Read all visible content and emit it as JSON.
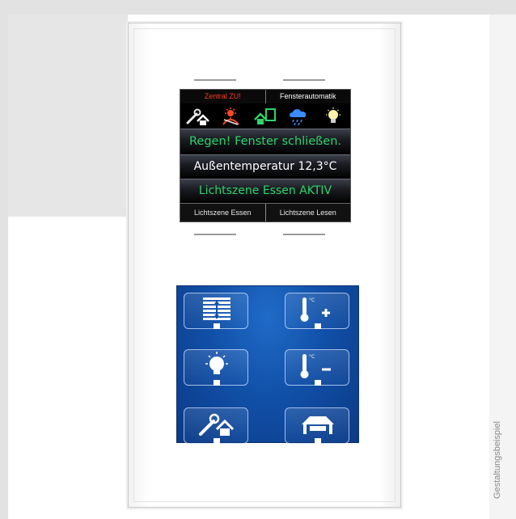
{
  "display": {
    "header": {
      "left": "Zentral ZU!",
      "right": "Fensterautomatik"
    },
    "status_icons": [
      "wrench-house-icon",
      "sun-shade-icon",
      "house-window-icon",
      "rain-cloud-icon",
      "lightbulb-icon"
    ],
    "message_rain": "Regen! Fenster schließen.",
    "outside_temperature": "Außentemperatur 12,3°C",
    "light_scene_active": "Lichtszene Essen AKTIV",
    "footer": {
      "left": "Lichtszene Essen",
      "right": "Lichtszene Lesen"
    }
  },
  "touch_keys": [
    {
      "name": "blinds-button",
      "icon": "blinds-icon"
    },
    {
      "name": "temperature-up-button",
      "icon": "thermometer-plus-icon"
    },
    {
      "name": "light-button",
      "icon": "lightbulb-icon"
    },
    {
      "name": "temperature-down-button",
      "icon": "thermometer-minus-icon"
    },
    {
      "name": "central-off-button",
      "icon": "wrench-house-icon"
    },
    {
      "name": "garage-button",
      "icon": "garage-icon"
    }
  ],
  "caption": "Gestaltungsbeispiel",
  "colors": {
    "header_left": "#ff3b1f",
    "header_right": "#ffffff",
    "rain_text": "#2fd36a",
    "temp_text": "#ffffff",
    "scene_text": "#2fd36a",
    "touch_blue": "#1150a8"
  }
}
